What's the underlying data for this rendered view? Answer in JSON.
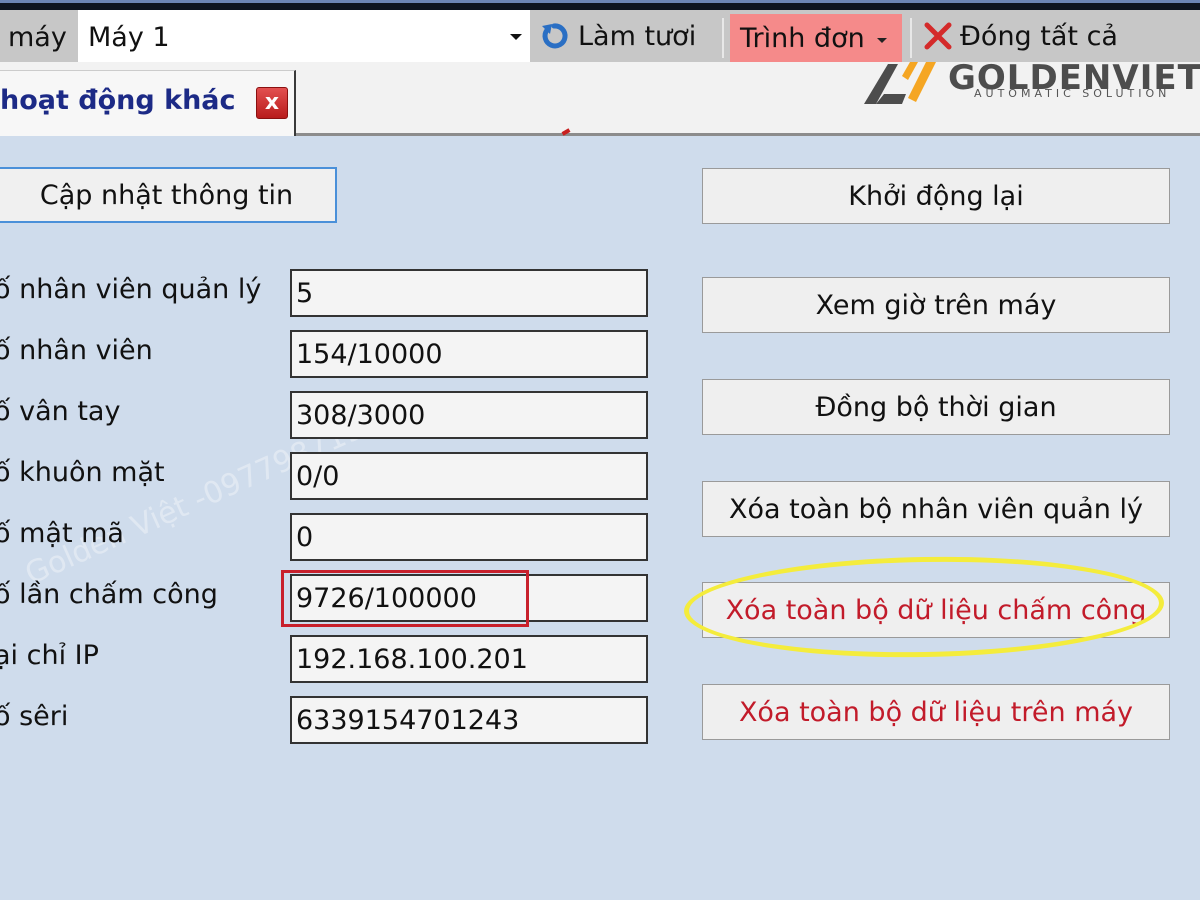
{
  "toolbar": {
    "device_label": "máy",
    "device_select_value": "Máy 1",
    "refresh_label": "Làm tươi",
    "menu_label": "Trình đơn",
    "close_all_label": "Đóng tất cả"
  },
  "tab": {
    "title": "hoạt động khác",
    "close_glyph": "x"
  },
  "logo": {
    "name": "GOLDENVIET",
    "tagline": "AUTOMATIC SOLUTION",
    "colors": {
      "gray": "#4d4d4d",
      "orange": "#f5a623"
    }
  },
  "main": {
    "update_button_label": "Cập nhật thông tin",
    "fields": [
      {
        "label": "ố nhân viên quản lý",
        "value": "5"
      },
      {
        "label": "ố nhân viên",
        "value": "154/10000"
      },
      {
        "label": "ố vân tay",
        "value": "308/3000"
      },
      {
        "label": "ố khuôn mặt",
        "value": "0/0"
      },
      {
        "label": "ố mật mã",
        "value": "0"
      },
      {
        "label": "ố lần chấm công",
        "value": "9726/100000"
      },
      {
        "label": "ại chỉ IP",
        "value": "192.168.100.201"
      },
      {
        "label": "ố sêri",
        "value": "6339154701243"
      }
    ],
    "actions": [
      {
        "label": "Khởi động lại"
      },
      {
        "label": "Xem giờ trên máy"
      },
      {
        "label": "Đồng bộ thời gian"
      },
      {
        "label": "Xóa toàn bộ nhân viên quản lý"
      },
      {
        "label": "Xóa toàn bộ dữ liệu chấm công"
      },
      {
        "label": "Xóa toàn bộ dữ liệu trên máy"
      }
    ]
  },
  "watermark": "Golden Việt -0977987191",
  "colors": {
    "background": "#cfdcec",
    "menu_highlight": "#f58a8a",
    "danger_text": "#c21b2a",
    "tab_title": "#1c2a86",
    "annotation_red": "#c8202c",
    "annotation_yellow": "#f4ec3c"
  }
}
